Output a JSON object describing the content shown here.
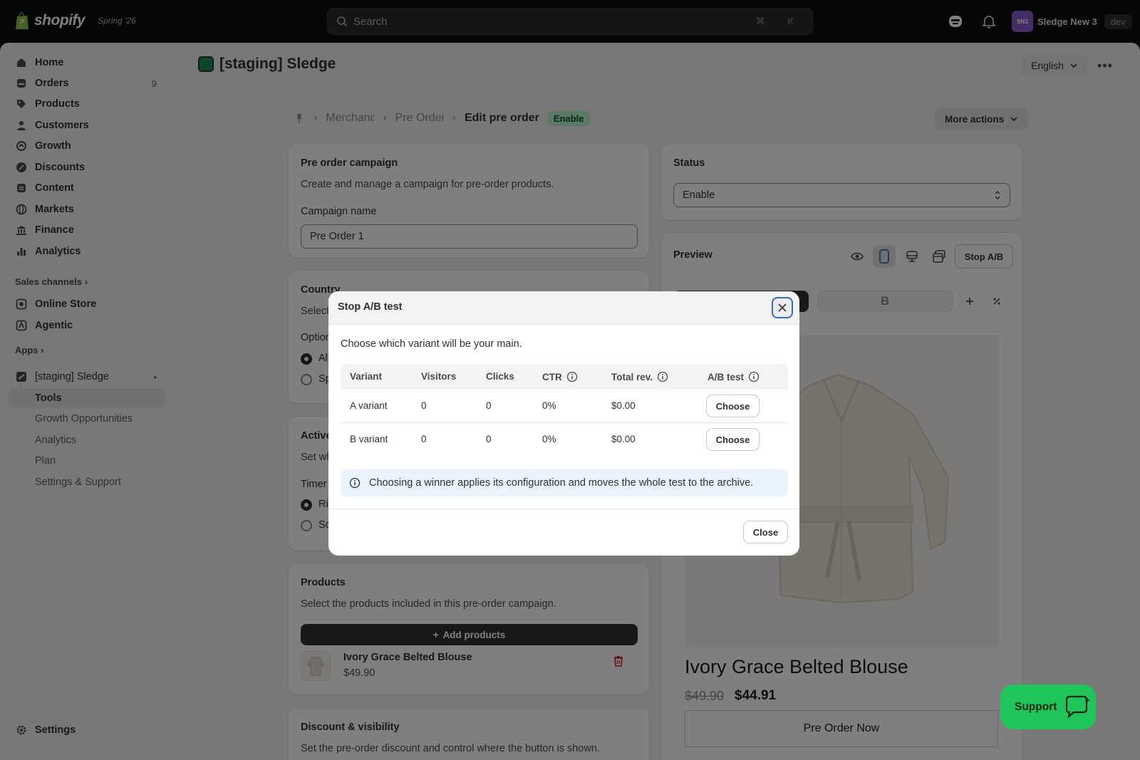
{
  "topbar": {
    "brand": "shopify",
    "edition": "Spring '26",
    "search_placeholder": "Search",
    "search_shortcut": "⌘ K",
    "store_initials": "SN3",
    "store_name": "Sledge New 3",
    "store_badge": "dev"
  },
  "sidebar": {
    "items": [
      {
        "label": "Home",
        "icon": "home-icon"
      },
      {
        "label": "Orders",
        "icon": "orders-icon",
        "count": "9"
      },
      {
        "label": "Products",
        "icon": "tag-icon"
      },
      {
        "label": "Customers",
        "icon": "person-icon"
      },
      {
        "label": "Growth",
        "icon": "growth-icon"
      },
      {
        "label": "Discounts",
        "icon": "discount-icon"
      },
      {
        "label": "Content",
        "icon": "content-icon"
      },
      {
        "label": "Markets",
        "icon": "globe-icon"
      },
      {
        "label": "Finance",
        "icon": "bank-icon"
      },
      {
        "label": "Analytics",
        "icon": "bar-chart-icon"
      }
    ],
    "sales_channels_heading": "Sales channels",
    "channels": [
      {
        "label": "Online Store",
        "icon": "store-icon"
      },
      {
        "label": "Agentic",
        "icon": "agentic-icon"
      }
    ],
    "apps_heading": "Apps",
    "app_name": "[staging] Sledge",
    "app_subitems": [
      "Tools",
      "Growth Opportunities",
      "Analytics",
      "Plan",
      "Settings & Support"
    ],
    "settings_label": "Settings"
  },
  "header": {
    "app_title": "[staging] Sledge",
    "language": "English",
    "breadcrumb": [
      "Merchandising",
      "Pre Order",
      "Edit pre order"
    ],
    "status_badge": "Enable",
    "more_actions": "More actions"
  },
  "campaign_card": {
    "title": "Pre order campaign",
    "description": "Create and manage a campaign for pre-order products.",
    "name_label": "Campaign name",
    "name_value": "Pre Order 1"
  },
  "country_card": {
    "title": "Country",
    "description_visible": "Select",
    "options_label": "Option",
    "opt_all": "Al",
    "opt_specific": "Sp"
  },
  "active_card": {
    "title": "Active",
    "description": "Set wh",
    "timer_label": "Timer",
    "opt1": "Ri",
    "opt2": "Sc"
  },
  "products_card": {
    "title": "Products",
    "description": "Select the products included in this pre-order campaign.",
    "add_button": "Add products",
    "product_name": "Ivory Grace Belted Blouse",
    "product_price": "$49.90"
  },
  "discount_card": {
    "title": "Discount & visibility",
    "description": "Set the pre-order discount and control where the button is shown."
  },
  "status_card": {
    "title": "Status",
    "select_value": "Enable"
  },
  "preview_card": {
    "title": "Preview",
    "stop_ab": "Stop A/B",
    "variant_b": "B",
    "product_title": "Ivory Grace Belted Blouse",
    "old_price": "$49.90",
    "new_price": "$44.91",
    "preorder_button": "Pre Order Now"
  },
  "modal": {
    "title": "Stop A/B test",
    "description": "Choose which variant will be your main.",
    "columns": [
      "Variant",
      "Visitors",
      "Clicks",
      "CTR",
      "Total rev.",
      "A/B test"
    ],
    "rows": [
      {
        "variant": "A variant",
        "visitors": "0",
        "clicks": "0",
        "ctr": "0%",
        "revenue": "$0.00",
        "action": "Choose"
      },
      {
        "variant": "B variant",
        "visitors": "0",
        "clicks": "0",
        "ctr": "0%",
        "revenue": "$0.00",
        "action": "Choose"
      }
    ],
    "info": "Choosing a winner applies its configuration and moves the whole test to the archive.",
    "close": "Close"
  },
  "support_button": "Support"
}
